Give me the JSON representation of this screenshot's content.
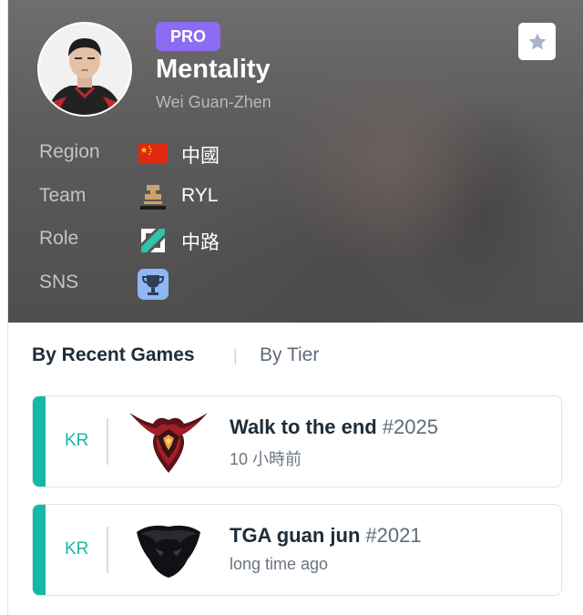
{
  "player": {
    "badge": "PRO",
    "name": "Mentality",
    "real_name": "Wei Guan-Zhen"
  },
  "info": {
    "region": {
      "label": "Region",
      "value": "中國",
      "icon": "china-flag-icon"
    },
    "team": {
      "label": "Team",
      "value": "RYL",
      "icon": "team-logo-icon"
    },
    "role": {
      "label": "Role",
      "value": "中路",
      "icon": "mid-lane-icon"
    },
    "sns": {
      "label": "SNS",
      "icon": "trophy-icon"
    }
  },
  "tabs": {
    "recent": "By Recent Games",
    "separator": "|",
    "tier": "By Tier"
  },
  "games": [
    {
      "region": "KR",
      "title": "Walk to the end",
      "tag": "#2025",
      "time": "10 小時前",
      "emblem": "master-tier-emblem-icon"
    },
    {
      "region": "KR",
      "title": "TGA guan jun",
      "tag": "#2021",
      "time": "long time ago",
      "emblem": "dark-tier-emblem-icon"
    }
  ],
  "colors": {
    "pro_badge": "#8b6cf2",
    "accent_teal": "#14b8a6",
    "header_bg": "#5d5c5c"
  }
}
